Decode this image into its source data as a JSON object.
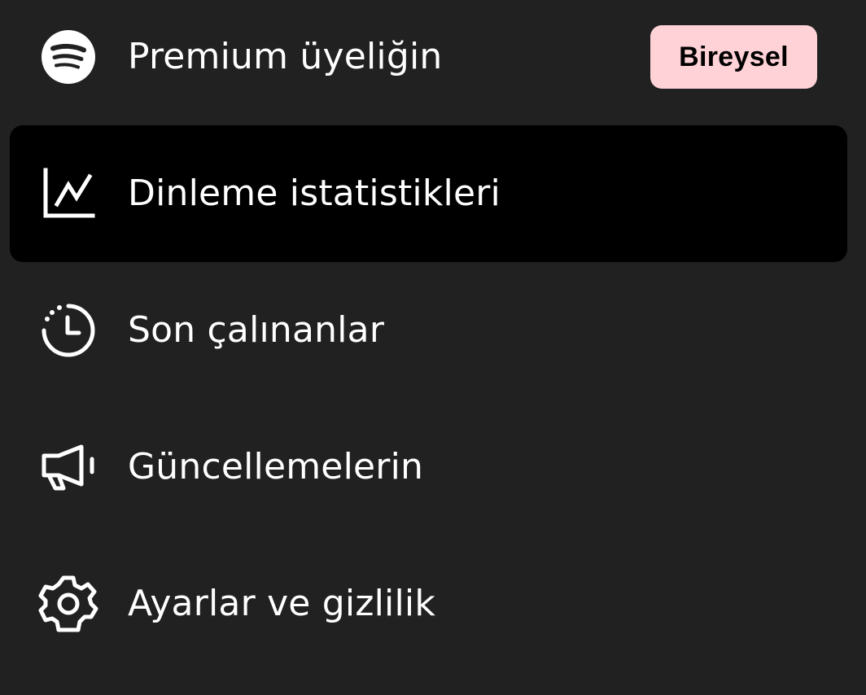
{
  "menu": {
    "items": [
      {
        "id": "premium",
        "label": "Premium üyeliğin",
        "icon": "spotify-logo-icon",
        "badge": "Bireysel",
        "active": false
      },
      {
        "id": "stats",
        "label": "Dinleme istatistikleri",
        "icon": "line-chart-icon",
        "active": true
      },
      {
        "id": "recent",
        "label": "Son çalınanlar",
        "icon": "recent-clock-icon",
        "active": false
      },
      {
        "id": "updates",
        "label": "Güncellemelerin",
        "icon": "megaphone-icon",
        "active": false
      },
      {
        "id": "settings",
        "label": "Ayarlar ve gizlilik",
        "icon": "gear-icon",
        "active": false
      }
    ]
  },
  "colors": {
    "background": "#212121",
    "active_row": "#000000",
    "text": "#ffffff",
    "badge_background": "#ffd2d7",
    "badge_text": "#000000"
  }
}
